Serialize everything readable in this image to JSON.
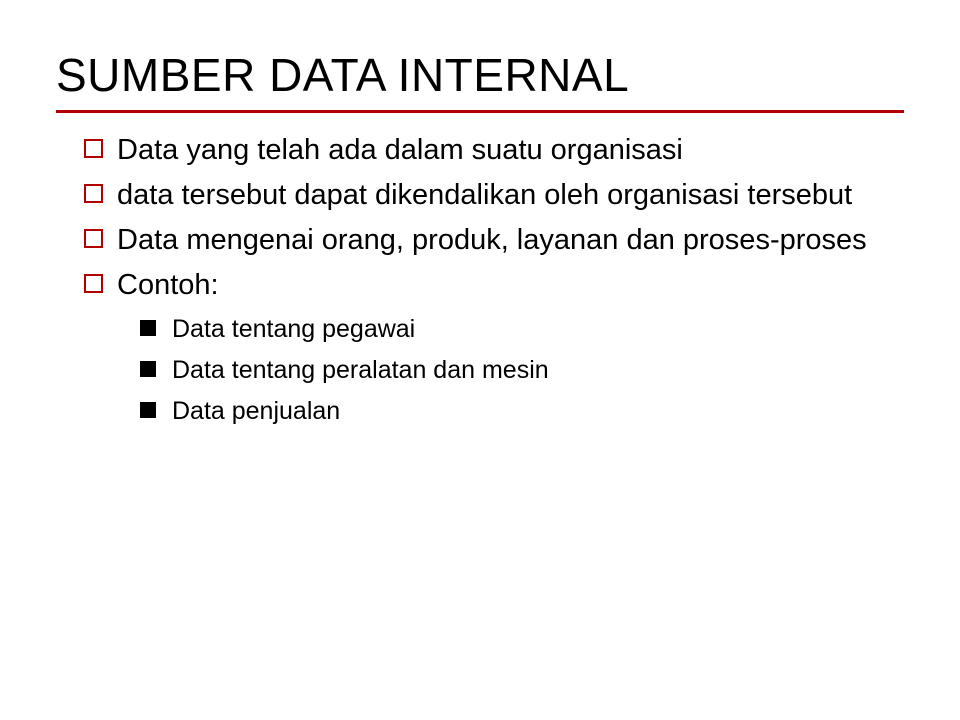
{
  "title": "SUMBER DATA INTERNAL",
  "bullets": [
    {
      "text": "Data yang telah ada dalam suatu organisasi"
    },
    {
      "text": "data tersebut dapat dikendalikan oleh organisasi tersebut"
    },
    {
      "text": "Data mengenai orang, produk, layanan dan proses-proses"
    },
    {
      "text": "Contoh:"
    }
  ],
  "subbullets": [
    {
      "text": "Data tentang pegawai"
    },
    {
      "text": "Data tentang peralatan dan mesin"
    },
    {
      "text": "Data penjualan"
    }
  ]
}
